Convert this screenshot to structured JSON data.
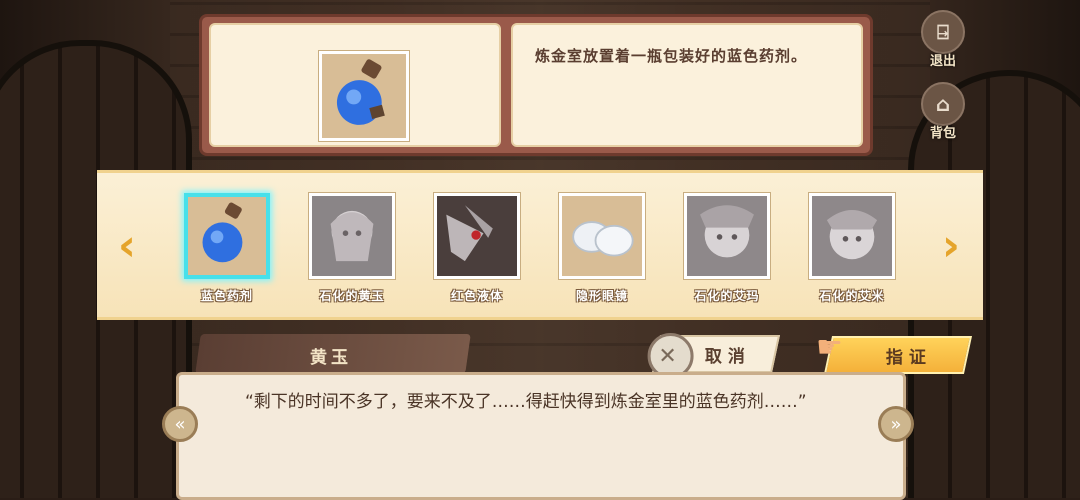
{
  "side_buttons": {
    "exit_label": "退出",
    "bag_label": "背包"
  },
  "selected_item": {
    "description": "炼金室放置着一瓶包装好的蓝色药剂。"
  },
  "items": [
    {
      "label": "蓝色药剂",
      "icon": "blue-potion-icon",
      "selected": true
    },
    {
      "label": "石化的黄玉",
      "icon": "petrified-character-icon",
      "selected": false
    },
    {
      "label": "红色液体",
      "icon": "red-liquid-hand-icon",
      "selected": false
    },
    {
      "label": "隐形眼镜",
      "icon": "contact-lenses-icon",
      "selected": false
    },
    {
      "label": "石化的艾玛",
      "icon": "petrified-character-icon",
      "selected": false
    },
    {
      "label": "石化的艾米",
      "icon": "petrified-character-icon",
      "selected": false
    }
  ],
  "dialogue": {
    "speaker": "黄玉",
    "text": "“剩下的时间不多了，要来不及了……得赶快得到炼金室里的蓝色药剂……”"
  },
  "actions": {
    "cancel_label": "取消",
    "confirm_label": "指证"
  },
  "colors": {
    "accent": "#f4b13a",
    "selection": "#47e0ea"
  }
}
